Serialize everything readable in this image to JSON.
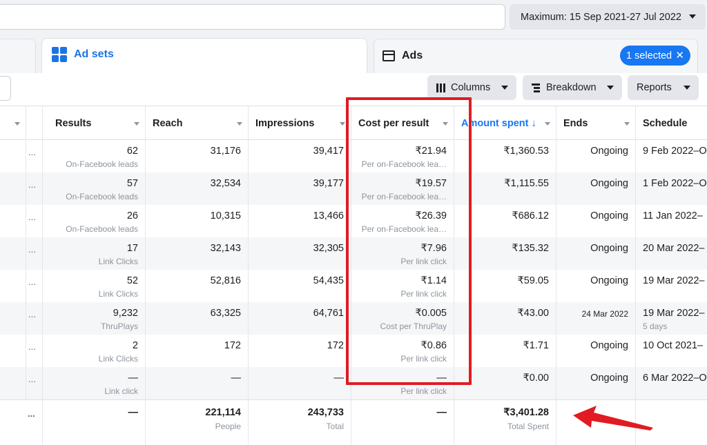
{
  "date_range": "Maximum: 15 Sep 2021-27 Jul 2022",
  "tabs": {
    "adsets_label": "Ad sets",
    "ads_label": "Ads",
    "selected_chip": "1 selected",
    "chip_close": "✕"
  },
  "toolbar": {
    "columns_label": "Columns",
    "breakdown_label": "Breakdown",
    "reports_label": "Reports",
    "left_button_glyph": "⟵"
  },
  "headers": {
    "results": "Results",
    "reach": "Reach",
    "impressions": "Impressions",
    "cost_per_result": "Cost per result",
    "amount_spent": "Amount spent ↓",
    "ends": "Ends",
    "schedule": "Schedule"
  },
  "rows": [
    {
      "results": "62",
      "results_sub": "On-Facebook leads",
      "reach": "31,176",
      "impressions": "39,417",
      "cpr": "₹21.94",
      "cpr_sub": "Per on-Facebook lea…",
      "spent": "₹1,360.53",
      "ends": "Ongoing",
      "schedule": "9 Feb 2022–O",
      "schedule_sub": ""
    },
    {
      "results": "57",
      "results_sub": "On-Facebook leads",
      "reach": "32,534",
      "impressions": "39,177",
      "cpr": "₹19.57",
      "cpr_sub": "Per on-Facebook lea…",
      "spent": "₹1,115.55",
      "ends": "Ongoing",
      "schedule": "1 Feb 2022–O",
      "schedule_sub": ""
    },
    {
      "results": "26",
      "results_sub": "On-Facebook leads",
      "reach": "10,315",
      "impressions": "13,466",
      "cpr": "₹26.39",
      "cpr_sub": "Per on-Facebook lea…",
      "spent": "₹686.12",
      "ends": "Ongoing",
      "schedule": "11 Jan 2022–",
      "schedule_sub": ""
    },
    {
      "results": "17",
      "results_sub": "Link Clicks",
      "reach": "32,143",
      "impressions": "32,305",
      "cpr": "₹7.96",
      "cpr_sub": "Per link click",
      "spent": "₹135.32",
      "ends": "Ongoing",
      "schedule": "20 Mar 2022–",
      "schedule_sub": ""
    },
    {
      "results": "52",
      "results_sub": "Link Clicks",
      "reach": "52,816",
      "impressions": "54,435",
      "cpr": "₹1.14",
      "cpr_sub": "Per link click",
      "spent": "₹59.05",
      "ends": "Ongoing",
      "schedule": "19 Mar 2022–",
      "schedule_sub": ""
    },
    {
      "results": "9,232",
      "results_sub": "ThruPlays",
      "reach": "63,325",
      "impressions": "64,761",
      "cpr": "₹0.005",
      "cpr_sub": "Cost per ThruPlay",
      "spent": "₹43.00",
      "ends": "24 Mar 2022",
      "schedule": "19 Mar 2022–",
      "schedule_sub": "5 days"
    },
    {
      "results": "2",
      "results_sub": "Link Clicks",
      "reach": "172",
      "impressions": "172",
      "cpr": "₹0.86",
      "cpr_sub": "Per link click",
      "spent": "₹1.71",
      "ends": "Ongoing",
      "schedule": "10 Oct 2021–",
      "schedule_sub": ""
    },
    {
      "results": "—",
      "results_sub": "Link click",
      "reach": "—",
      "impressions": "—",
      "cpr": "—",
      "cpr_sub": "Per link click",
      "spent": "₹0.00",
      "ends": "Ongoing",
      "schedule": "6 Mar 2022–O",
      "schedule_sub": ""
    }
  ],
  "row_dots": "...",
  "totals": {
    "results": "—",
    "reach": "221,114",
    "reach_sub": "People",
    "impressions": "243,733",
    "impressions_sub": "Total",
    "cpr": "—",
    "spent": "₹3,401.28",
    "spent_sub": "Total Spent"
  },
  "colors": {
    "accent": "#1877f2",
    "annotation": "#e11b22"
  }
}
